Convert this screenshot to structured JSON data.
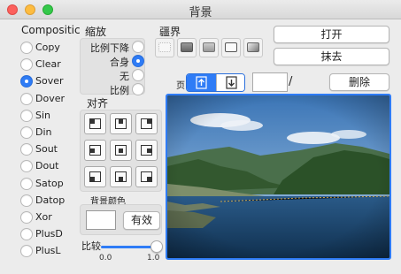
{
  "window": {
    "title": "背景"
  },
  "composition": {
    "title": "Compositic",
    "selected_index": 2,
    "items": [
      "Copy",
      "Clear",
      "Sover",
      "Dover",
      "Sin",
      "Din",
      "Sout",
      "Dout",
      "Satop",
      "Datop",
      "Xor",
      "PlusD",
      "PlusL"
    ]
  },
  "scale": {
    "title": "缩放",
    "selected_index": 1,
    "items": [
      "比例下降",
      "合身",
      "无",
      "比例"
    ]
  },
  "align": {
    "title": "对齐"
  },
  "background_color": {
    "title": "背景颜色",
    "value": "#ffffff",
    "effective_label": "有效"
  },
  "ratio": {
    "label": "比较",
    "min_label": "0.0",
    "max_label": "1.0",
    "value": 1.0
  },
  "border": {
    "title": "疆界"
  },
  "page": {
    "label": "页",
    "suffix": "/",
    "value": ""
  },
  "buttons": {
    "open": "打开",
    "erase": "抹去",
    "delete": "删除"
  }
}
